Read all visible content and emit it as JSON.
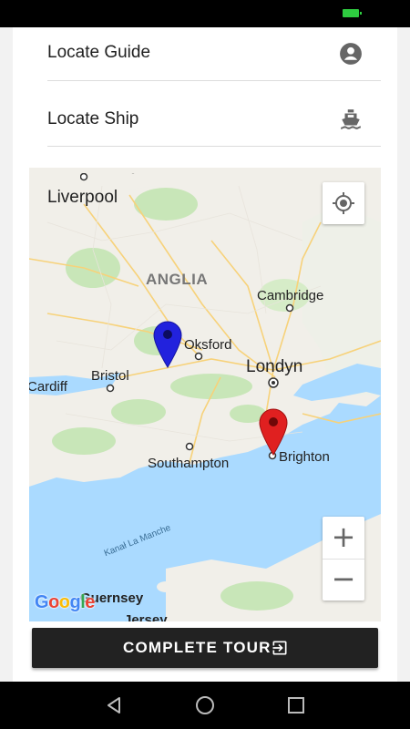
{
  "menu": {
    "locate_guide": {
      "label": "Locate Guide",
      "icon": "account-circle-icon"
    },
    "locate_ship": {
      "label": "Locate Ship",
      "icon": "ship-icon"
    }
  },
  "map": {
    "labels": {
      "liverpool": "Liverpool",
      "anglia": "ANGLIA",
      "cambridge": "Cambridge",
      "oksford": "Oksford",
      "londyn": "Londyn",
      "bristol": "Bristol",
      "cardiff": "Cardiff",
      "brighton": "Brighton",
      "southampton": "Southampton",
      "kanal": "Kanał La Manche",
      "guernsey": "Guernsey",
      "jersey": "Jersey"
    },
    "google": "Google",
    "markers": [
      {
        "name": "guide",
        "color": "#2222dd"
      },
      {
        "name": "ship",
        "color": "#e02020"
      }
    ],
    "zoom_in": "+",
    "zoom_out": "−"
  },
  "complete_button": {
    "label": "COMPLETE TOUR"
  },
  "colors": {
    "accent_dark": "#222222",
    "status_battery": "#2ecc40"
  }
}
